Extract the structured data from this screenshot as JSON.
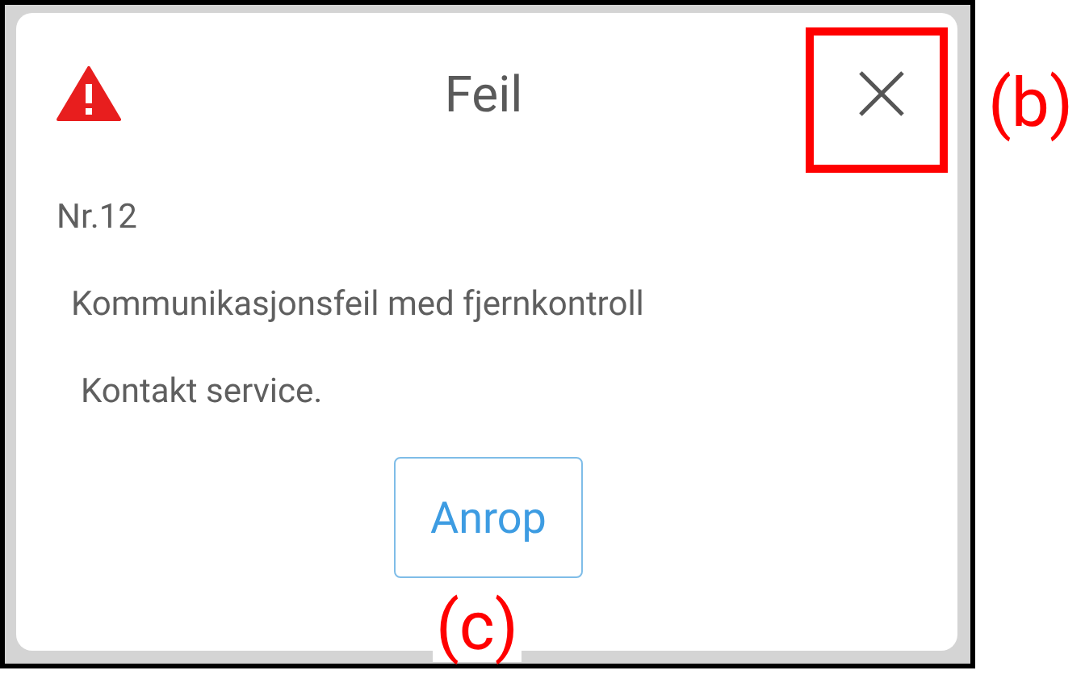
{
  "dialog": {
    "title": "Feil",
    "code": "Nr.12",
    "message": "Kommunikasjonsfeil med fjernkontroll",
    "hint": "Kontakt service.",
    "button": "Anrop"
  },
  "annotations": [
    {
      "label": "(b)",
      "kind": "framed"
    },
    {
      "label": "(c)",
      "kind": "plain"
    }
  ]
}
